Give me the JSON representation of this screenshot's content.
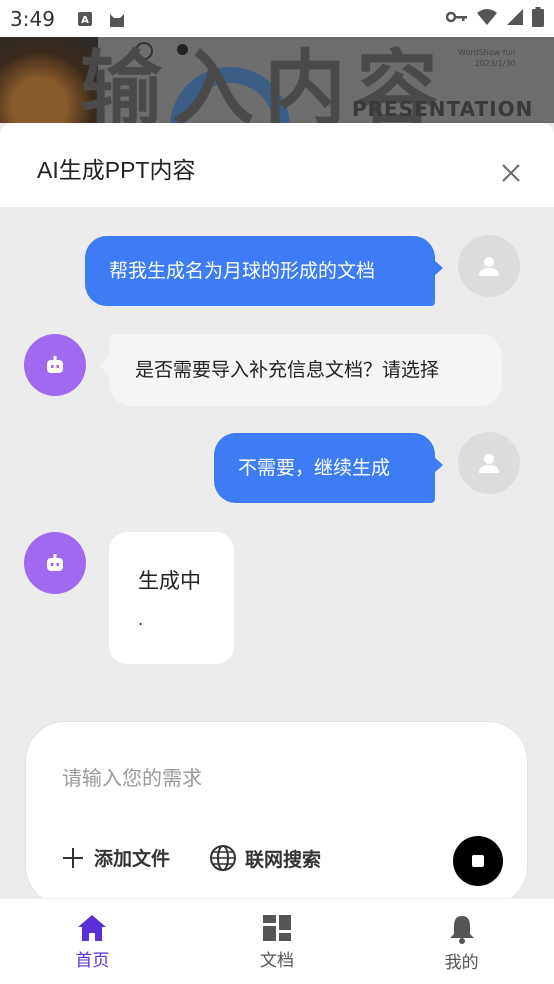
{
  "status_bar": {
    "time": "3:49",
    "icons": [
      "a-letter-icon",
      "cat-app-icon",
      "key-icon",
      "wifi-icon",
      "signal-icon",
      "battery-icon"
    ]
  },
  "background": {
    "big_text": "输入内容",
    "small_text": "PRESENTATION",
    "tiny_text_1": "WordShow fun",
    "tiny_text_2": "2023/1/30"
  },
  "sheet": {
    "title": "AI生成PPT内容",
    "close_icon": "close-icon"
  },
  "messages": [
    {
      "role": "user",
      "text": "帮我生成名为月球的形成的文档"
    },
    {
      "role": "bot",
      "text": "是否需要导入补充信息文档？请选择"
    },
    {
      "role": "user",
      "text": "不需要，继续生成"
    },
    {
      "role": "bot",
      "text": "生成中",
      "progress_dots": "."
    }
  ],
  "input": {
    "placeholder": "请输入您的需求",
    "add_file_label": "添加文件",
    "web_search_label": "联网搜索"
  },
  "nav": {
    "items": [
      {
        "label": "首页",
        "icon": "home-icon",
        "active": true
      },
      {
        "label": "文档",
        "icon": "grid-icon",
        "active": false
      },
      {
        "label": "我的",
        "icon": "bell-icon",
        "active": false
      }
    ]
  },
  "colors": {
    "accent": "#3d7cf5",
    "bot_avatar": "#a06af0",
    "nav_active": "#5a2fd6"
  }
}
